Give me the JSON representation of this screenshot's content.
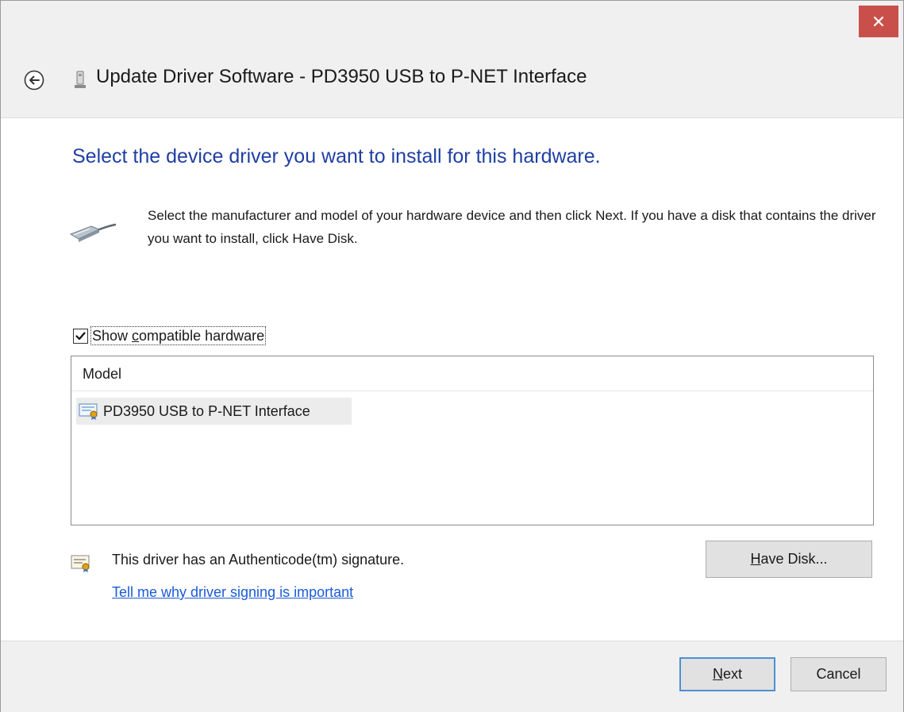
{
  "window": {
    "title": "Update Driver Software - PD3950 USB to P-NET Interface",
    "close_glyph": "✕"
  },
  "page": {
    "heading": "Select the device driver you want to install for this hardware.",
    "instructions": "Select the manufacturer and model of your hardware device and then click Next. If you have a disk that contains the driver you want to install, click Have Disk."
  },
  "compat": {
    "checked": true,
    "label_prefix": "Show ",
    "label_accel": "c",
    "label_suffix": "ompatible hardware"
  },
  "model_list": {
    "header": "Model",
    "items": [
      {
        "label": "PD3950 USB to P-NET Interface",
        "selected": true
      }
    ]
  },
  "signature": {
    "text": "This driver has an Authenticode(tm) signature.",
    "link": "Tell me why driver signing is important"
  },
  "buttons": {
    "have_disk_accel": "H",
    "have_disk_rest": "ave Disk...",
    "next_accel": "N",
    "next_rest": "ext",
    "cancel": "Cancel"
  },
  "colors": {
    "heading": "#1f3fa3",
    "link": "#1a5bd6",
    "close_button": "#c9504a",
    "default_button_border": "#4d8fd6"
  }
}
